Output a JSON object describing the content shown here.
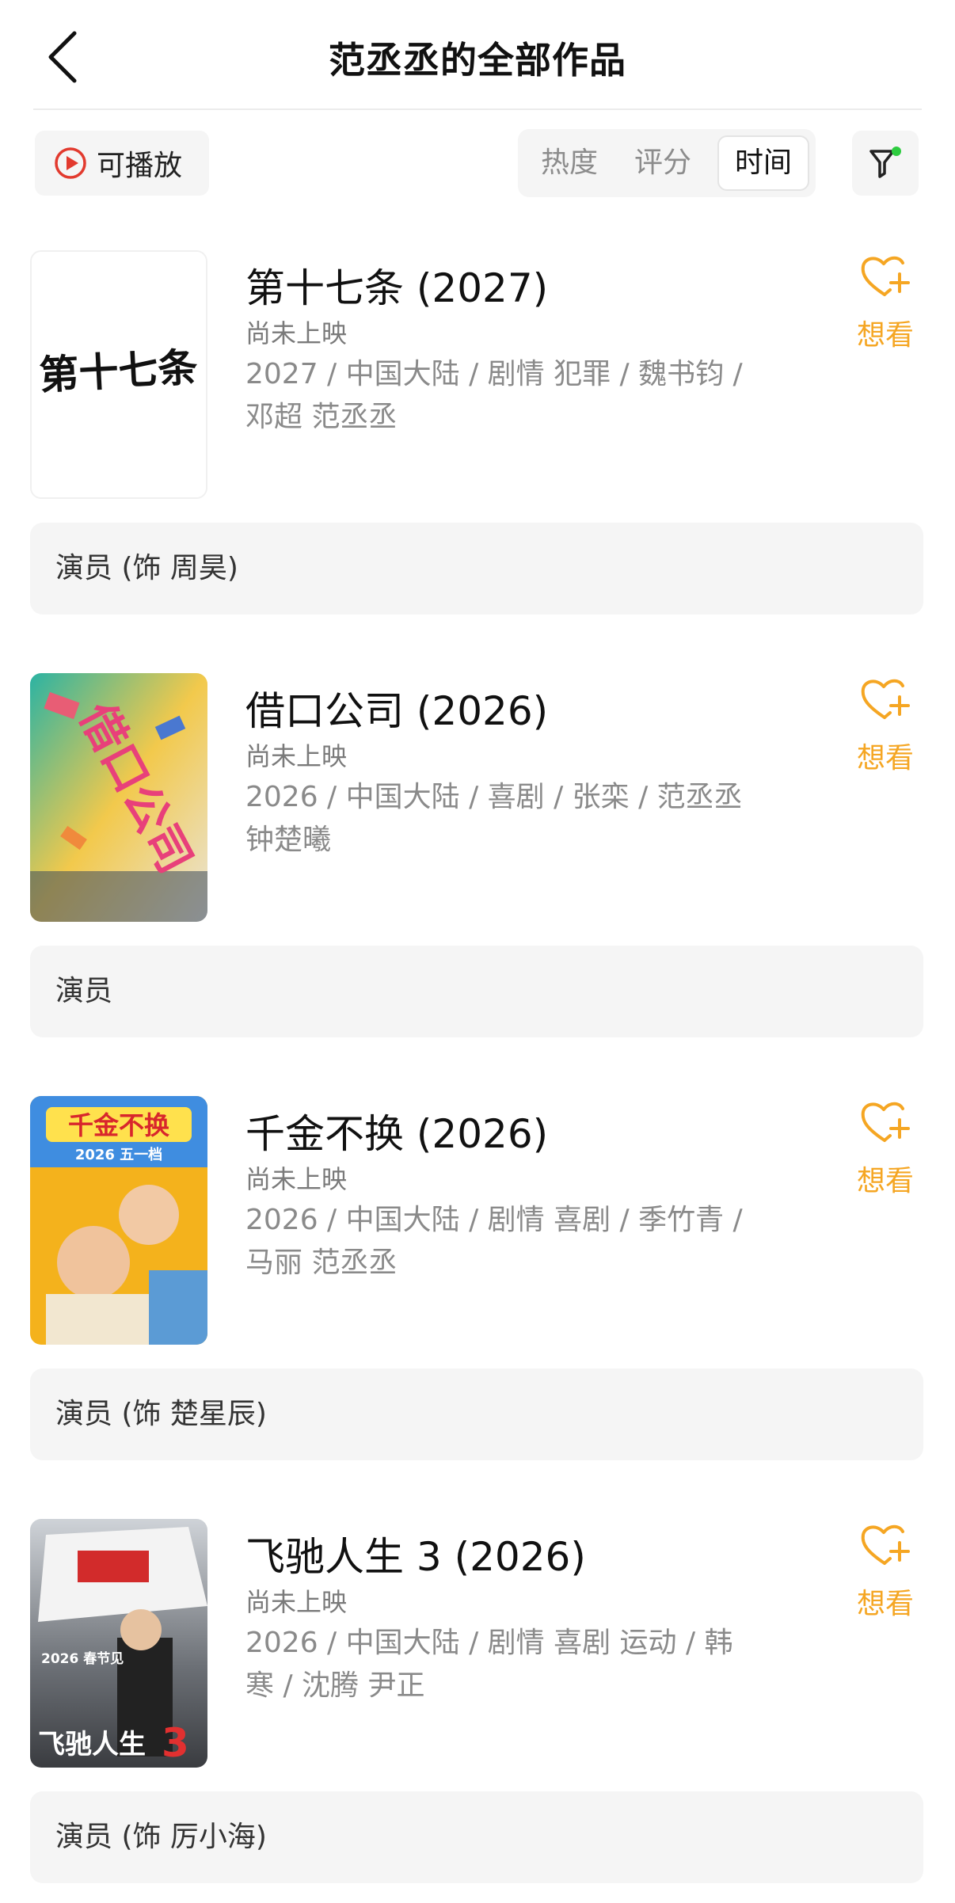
{
  "header": {
    "title": "范丞丞的全部作品"
  },
  "toolbar": {
    "playable_label": "可播放",
    "sort_options": [
      "热度",
      "评分",
      "时间"
    ],
    "active_sort": "时间",
    "filter_dot_color": "#2ecc40"
  },
  "colors": {
    "accent": "#f5a623",
    "play_red": "#e23a2e"
  },
  "movies": [
    {
      "title": "第十七条 (2027)",
      "status": "尚未上映",
      "info_line1": "2027 / 中国大陆 / 剧情 犯罪 / 魏书钧 /",
      "info_line2": "邓超 范丞丞",
      "want_label": "想看",
      "role": "演员 (饰 周昊)",
      "poster_text": "第十七条"
    },
    {
      "title": "借口公司 (2026)",
      "status": "尚未上映",
      "info_line1": "2026 / 中国大陆 / 喜剧 / 张栾 / 范丞丞",
      "info_line2": "钟楚曦",
      "want_label": "想看",
      "role": "演员",
      "poster_text": "借口公司"
    },
    {
      "title": "千金不换 (2026)",
      "status": "尚未上映",
      "info_line1": "2026 / 中国大陆 / 剧情 喜剧 / 季竹青 /",
      "info_line2": "马丽 范丞丞",
      "want_label": "想看",
      "role": "演员 (饰 楚星辰)",
      "poster_text": "千金不换",
      "poster_subtext": "2026 五一档"
    },
    {
      "title": "飞驰人生 3 (2026)",
      "status": "尚未上映",
      "info_line1": "2026 / 中国大陆 / 剧情 喜剧 运动 / 韩",
      "info_line2": "寒 / 沈腾 尹正",
      "want_label": "想看",
      "role": "演员 (饰 厉小海)",
      "poster_text": "飞驰人生",
      "poster_number": "3",
      "poster_subtext": "2026 春节见"
    }
  ]
}
